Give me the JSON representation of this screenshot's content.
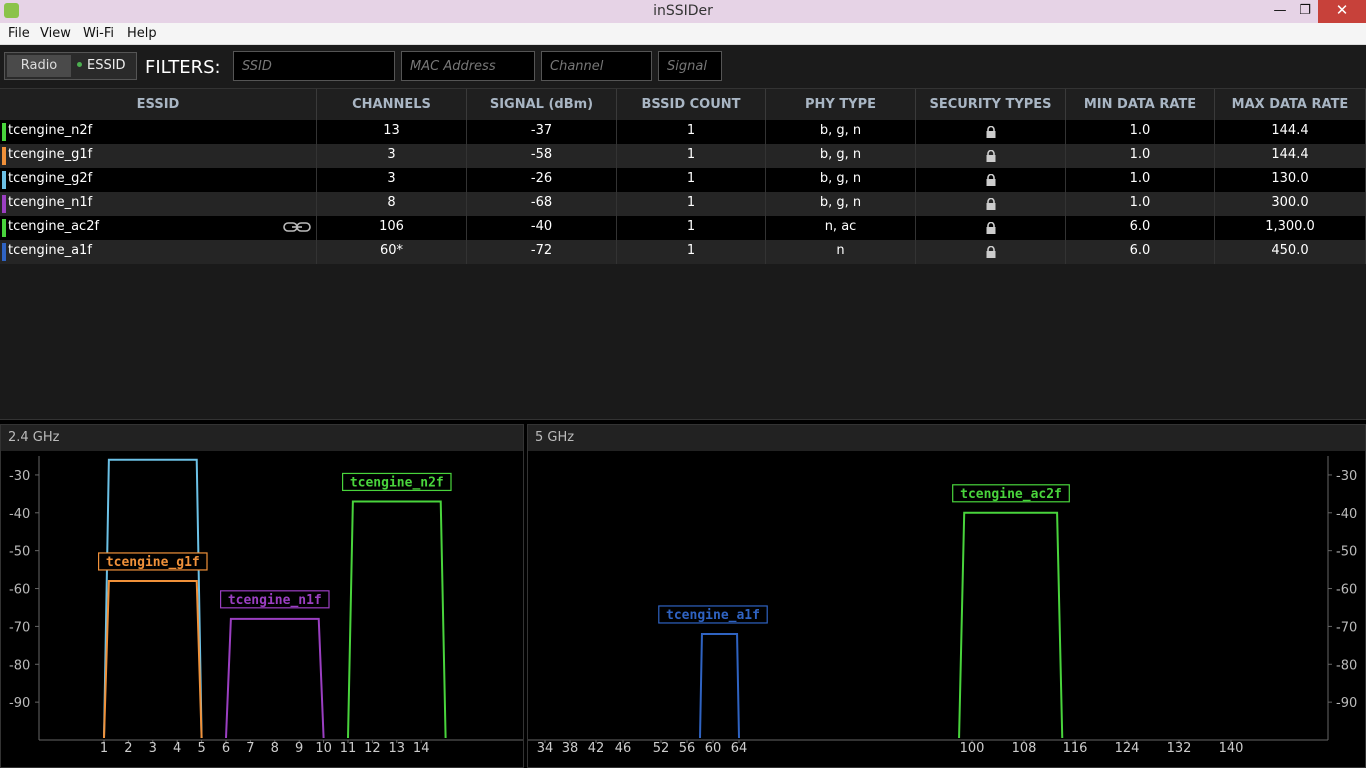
{
  "window": {
    "title": "inSSIDer"
  },
  "menu": [
    "File",
    "View",
    "Wi-Fi",
    "Help"
  ],
  "toggle": {
    "radio_label": "Radio",
    "essid_label": "ESSID"
  },
  "filters": {
    "label": "FILTERS:",
    "ssid_placeholder": "SSID",
    "mac_placeholder": "MAC Address",
    "channel_placeholder": "Channel",
    "signal_placeholder": "Signal"
  },
  "table": {
    "columns": [
      "ESSID",
      "CHANNELS",
      "SIGNAL (dBm)",
      "BSSID COUNT",
      "PHY TYPE",
      "SECURITY TYPES",
      "MIN DATA RATE",
      "MAX DATA RATE"
    ],
    "rows": [
      {
        "essid": "tcengine_n2f",
        "channels": "13",
        "signal": "-37",
        "bssid": "1",
        "phy": "b, g, n",
        "min": "1.0",
        "max": "144.4",
        "color": "#49d43c"
      },
      {
        "essid": "tcengine_g1f",
        "channels": "3",
        "signal": "-58",
        "bssid": "1",
        "phy": "b, g, n",
        "min": "1.0",
        "max": "144.4",
        "color": "#f0913a"
      },
      {
        "essid": "tcengine_g2f",
        "channels": "3",
        "signal": "-26",
        "bssid": "1",
        "phy": "b, g, n",
        "min": "1.0",
        "max": "130.0",
        "color": "#6cc1e6"
      },
      {
        "essid": "tcengine_n1f",
        "channels": "8",
        "signal": "-68",
        "bssid": "1",
        "phy": "b, g, n",
        "min": "1.0",
        "max": "300.0",
        "color": "#9b3fc2"
      },
      {
        "essid": "tcengine_ac2f",
        "channels": "106",
        "signal": "-40",
        "bssid": "1",
        "phy": "n, ac",
        "min": "6.0",
        "max": "1,300.0",
        "color": "#49d43c"
      },
      {
        "essid": "tcengine_a1f",
        "channels": "60*",
        "signal": "-72",
        "bssid": "1",
        "phy": "n",
        "min": "6.0",
        "max": "450.0",
        "color": "#2f63c2"
      }
    ]
  },
  "chart_data": [
    {
      "type": "area",
      "title": "2.4 GHz",
      "ylim": [
        -100,
        -25
      ],
      "yticks": [
        -30,
        -40,
        -50,
        -60,
        -70,
        -80,
        -90
      ],
      "xticks": [
        "1",
        "2",
        "3",
        "4",
        "5",
        "6",
        "7",
        "8",
        "9",
        "10",
        "11",
        "12",
        "13",
        "14"
      ],
      "xtick_values": [
        1,
        2,
        3,
        4,
        5,
        6,
        7,
        8,
        9,
        10,
        11,
        12,
        13,
        14
      ],
      "series": [
        {
          "name": "tcengine_g2f",
          "center": 3,
          "from": 1,
          "to": 5,
          "signal": -26,
          "color": "#6cc1e6"
        },
        {
          "name": "tcengine_g1f",
          "center": 3,
          "from": 1,
          "to": 5,
          "signal": -58,
          "color": "#f0913a"
        },
        {
          "name": "tcengine_n1f",
          "center": 8,
          "from": 6,
          "to": 10,
          "signal": -68,
          "color": "#9b3fc2"
        },
        {
          "name": "tcengine_n2f",
          "center": 13,
          "from": 11,
          "to": 15,
          "signal": -37,
          "color": "#49d43c"
        }
      ]
    },
    {
      "type": "area",
      "title": "5 GHz",
      "ylim": [
        -100,
        -25
      ],
      "yticks": [
        -30,
        -40,
        -50,
        -60,
        -70,
        -80,
        -90
      ],
      "xticks": [
        "34",
        "38",
        "42",
        "46",
        "52",
        "56",
        "60",
        "64",
        "100",
        "108",
        "116",
        "124",
        "132",
        "140"
      ],
      "xtick_values": [
        34,
        38,
        42,
        46,
        52,
        56,
        60,
        64,
        100,
        108,
        116,
        124,
        132,
        140
      ],
      "series": [
        {
          "name": "tcengine_a1f",
          "center": 60,
          "from": 58,
          "to": 64,
          "signal": -72,
          "color": "#2f63c2"
        },
        {
          "name": "tcengine_ac2f",
          "center": 106,
          "from": 98,
          "to": 114,
          "signal": -40,
          "color": "#49d43c"
        }
      ]
    }
  ]
}
